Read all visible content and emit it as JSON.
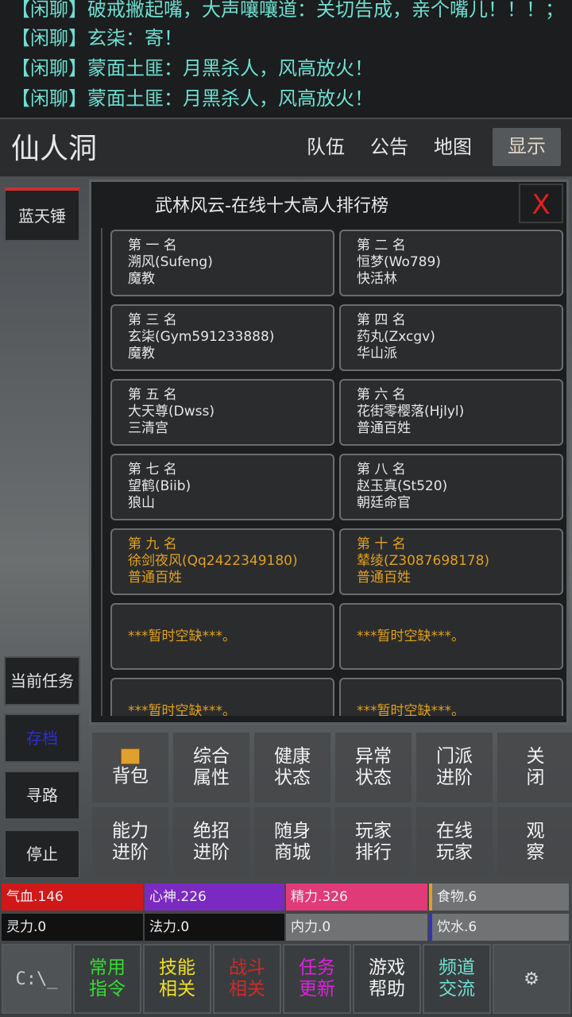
{
  "chat": {
    "lines": [
      "【闲聊】破戒撇起嘴，大声嚷嚷道：关切告成，亲个嘴儿！！！；",
      "【闲聊】玄柒：寄！",
      "【闲聊】蒙面土匪：月黑杀人，风高放火！",
      "【闲聊】蒙面土匪：月黑杀人，风高放火！"
    ]
  },
  "location": {
    "title": "仙人洞",
    "buttons": [
      "队伍",
      "公告",
      "地图",
      "显示"
    ]
  },
  "left": {
    "weapon": "蓝天锤",
    "current_task": "当前任务",
    "btn2": "存档",
    "pathfind": "寻路",
    "stop": "停止"
  },
  "panel": {
    "title": "武林风云-在线十大高人排行榜",
    "close": "X",
    "ranks": [
      {
        "rank": "第 一 名",
        "name": "溯风(Sufeng)",
        "sect": "魔教"
      },
      {
        "rank": "第 二 名",
        "name": "恒梦(Wo789)",
        "sect": "快活林"
      },
      {
        "rank": "第 三 名",
        "name": "玄柒(Gym591233888)",
        "sect": "魔教"
      },
      {
        "rank": "第 四 名",
        "name": "药丸(Zxcgv)",
        "sect": "华山派"
      },
      {
        "rank": "第 五 名",
        "name": "大天尊(Dwss)",
        "sect": "三清宫"
      },
      {
        "rank": "第 六 名",
        "name": "花街零樱落(Hjlyl)",
        "sect": "普通百姓"
      },
      {
        "rank": "第 七 名",
        "name": "望鹤(Biib)",
        "sect": "狼山"
      },
      {
        "rank": "第 八 名",
        "name": "赵玉真(St520)",
        "sect": "朝廷命官"
      },
      {
        "rank": "第 九 名",
        "name": "徐剑夜风(Qq2422349180)",
        "sect": "普通百姓"
      },
      {
        "rank": "第 十 名",
        "name": "辇绫(Z3087698178)",
        "sect": "普通百姓"
      }
    ],
    "empty": [
      "***暂时空缺***。",
      "***暂时空缺***。",
      "***暂时空缺***。",
      "***暂时空缺***。"
    ]
  },
  "menu": {
    "row1": [
      [
        "背包"
      ],
      [
        "综合",
        "属性"
      ],
      [
        "健康",
        "状态"
      ],
      [
        "异常",
        "状态"
      ],
      [
        "门派",
        "进阶"
      ],
      [
        "关",
        "闭"
      ]
    ],
    "row2": [
      [
        "能力",
        "进阶"
      ],
      [
        "绝招",
        "进阶"
      ],
      [
        "随身",
        "商城"
      ],
      [
        "玩家",
        "排行"
      ],
      [
        "在线",
        "玩家"
      ],
      [
        "观",
        "察"
      ]
    ]
  },
  "stats": {
    "qixue": "气血.146",
    "xinshen": "心神.226",
    "jingli": "精力.326",
    "shiwu": "食物.6",
    "lingli": "灵力.0",
    "fali": "法力.0",
    "neili": "内力.0",
    "yinshui": "饮水.6"
  },
  "bottom": {
    "items": [
      [
        "常用",
        "指令"
      ],
      [
        "技能",
        "相关"
      ],
      [
        "战斗",
        "相关"
      ],
      [
        "任务",
        "更新"
      ],
      [
        "游戏",
        "帮助"
      ],
      [
        "频道",
        "交流"
      ]
    ],
    "colors": [
      "#33dd33",
      "#f0e020",
      "#cc2a2a",
      "#dd22dd",
      "#f0f0f0",
      "#6fdfd0"
    ]
  }
}
